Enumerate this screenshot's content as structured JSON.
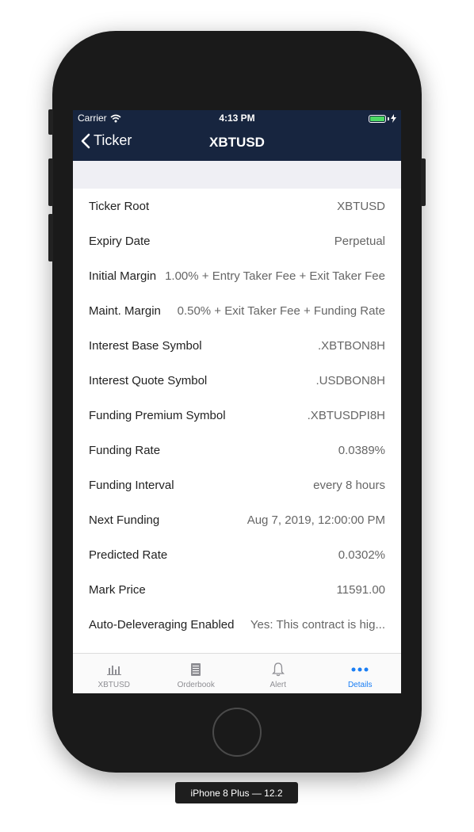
{
  "status_bar": {
    "carrier": "Carrier",
    "time": "4:13 PM"
  },
  "nav": {
    "back_label": "Ticker",
    "title": "XBTUSD"
  },
  "rows": [
    {
      "label": "Ticker Root",
      "value": "XBTUSD"
    },
    {
      "label": "Expiry Date",
      "value": "Perpetual"
    },
    {
      "label": "Initial Margin",
      "value": "1.00% + Entry Taker Fee + Exit Taker Fee"
    },
    {
      "label": "Maint. Margin",
      "value": "0.50% + Exit Taker Fee + Funding Rate"
    },
    {
      "label": "Interest Base Symbol",
      "value": ".XBTBON8H"
    },
    {
      "label": "Interest Quote Symbol",
      "value": ".USDBON8H"
    },
    {
      "label": "Funding Premium Symbol",
      "value": ".XBTUSDPI8H"
    },
    {
      "label": "Funding Rate",
      "value": "0.0389%"
    },
    {
      "label": "Funding Interval",
      "value": "every 8 hours"
    },
    {
      "label": "Next Funding",
      "value": "Aug 7, 2019, 12:00:00 PM"
    },
    {
      "label": "Predicted Rate",
      "value": "0.0302%"
    },
    {
      "label": "Mark Price",
      "value": "11591.00"
    },
    {
      "label": "Auto-Deleveraging Enabled",
      "value": "Yes: This contract is hig..."
    }
  ],
  "tabs": [
    {
      "label": "XBTUSD",
      "icon": "chart-icon"
    },
    {
      "label": "Orderbook",
      "icon": "orderbook-icon"
    },
    {
      "label": "Alert",
      "icon": "bell-icon"
    },
    {
      "label": "Details",
      "icon": "more-icon"
    }
  ],
  "device_label": "iPhone 8 Plus — 12.2",
  "colors": {
    "nav_bg": "#17253f",
    "accent": "#1a7ef4",
    "battery": "#4cd964"
  }
}
